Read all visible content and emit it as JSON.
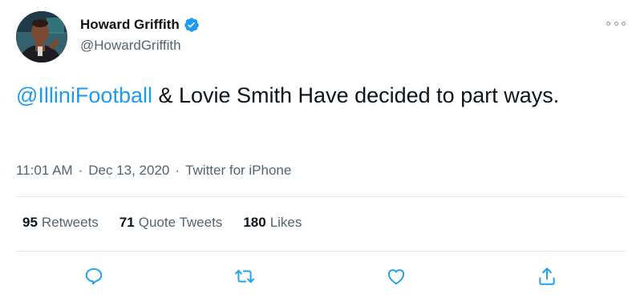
{
  "author": {
    "display_name": "Howard Griffith",
    "handle": "@HowardGriffith",
    "verified": true
  },
  "tweet": {
    "mention": "@IlliniFootball",
    "text_rest": " & Lovie Smith Have decided to part ways."
  },
  "meta": {
    "time": "11:01 AM",
    "date": "Dec 13, 2020",
    "source": "Twitter for iPhone",
    "separator": "·"
  },
  "stats": {
    "retweets": {
      "count": "95",
      "label": "Retweets"
    },
    "quote_tweets": {
      "count": "71",
      "label": "Quote Tweets"
    },
    "likes": {
      "count": "180",
      "label": "Likes"
    }
  },
  "colors": {
    "link": "#1d9bf0",
    "secondary_text": "#536471",
    "divider": "#e1e8ed",
    "icon": "#1da1f2"
  },
  "icons": {
    "more": "more-icon",
    "reply": "reply-icon",
    "retweet": "retweet-icon",
    "like": "like-icon",
    "share": "share-icon",
    "verified": "verified-badge-icon"
  }
}
